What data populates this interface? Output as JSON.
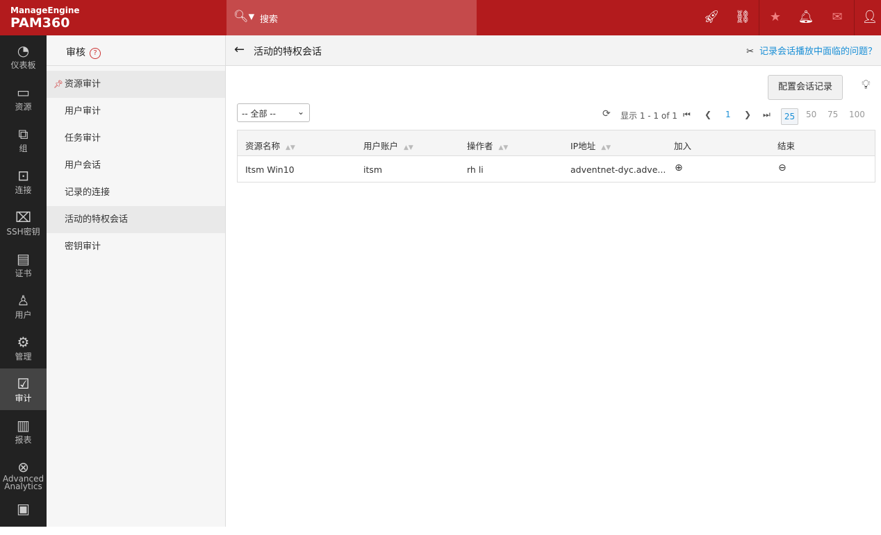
{
  "header": {
    "brand": "ManageEngine",
    "product": "PAM360",
    "search_label": "搜索"
  },
  "nav": [
    {
      "label": "仪表板",
      "icon": "dashboard-icon"
    },
    {
      "label": "资源",
      "icon": "monitor-icon"
    },
    {
      "label": "组",
      "icon": "group-icon"
    },
    {
      "label": "连接",
      "icon": "connect-icon"
    },
    {
      "label": "SSH密钥",
      "icon": "ssh-key-icon"
    },
    {
      "label": "证书",
      "icon": "certificate-icon"
    },
    {
      "label": "用户",
      "icon": "user-icon"
    },
    {
      "label": "管理",
      "icon": "gear-icon"
    },
    {
      "label": "审计",
      "icon": "clipboard-check-icon"
    },
    {
      "label": "报表",
      "icon": "bar-chart-icon"
    },
    {
      "label": "Advanced Analytics",
      "icon": "analytics-icon"
    }
  ],
  "sub": {
    "title": "审核",
    "help": "?",
    "items": [
      "资源审计",
      "用户审计",
      "任务审计",
      "用户会话",
      "记录的连接",
      "活动的特权会话",
      "密钥审计"
    ]
  },
  "main": {
    "title": "活动的特权会话",
    "help_link": "记录会话播放中面临的问题？",
    "config_button": "配置会话记录",
    "filter": "-- 全部 --",
    "pagination": {
      "summary": "显示 1 - 1 of 1",
      "page": "1",
      "sizes": [
        "25",
        "50",
        "75",
        "100"
      ]
    },
    "columns": [
      "资源名称",
      "用户账户",
      "操作者",
      "IP地址",
      "加入",
      "结束"
    ],
    "rows": [
      {
        "resource": "Itsm Win10",
        "account": "itsm",
        "operator": "rh li",
        "ip": "adventnet-dyc.adve..."
      }
    ]
  }
}
